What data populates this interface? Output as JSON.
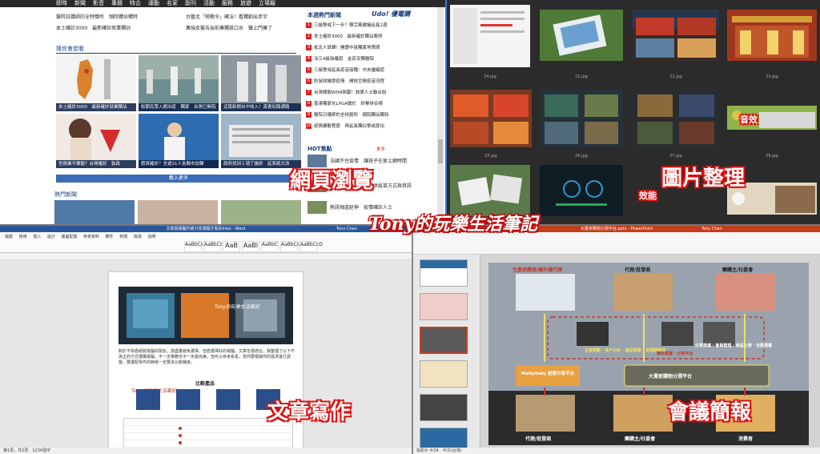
{
  "banner": "Tony的玩樂生活筆記",
  "quadrant_titles": {
    "web": "網頁瀏覽",
    "photos": "圖片整理",
    "writing": "文章寫作",
    "meeting": "會議簡報"
  },
  "news": {
    "nav": [
      "即時",
      "新聞",
      "影音",
      "專題",
      "特企",
      "運動",
      "名家",
      "副刊",
      "活動",
      "服務",
      "旅遊",
      "立場報"
    ],
    "brand": "Udo! 優電購",
    "top_headlines": [
      "醫院日護師的全特獎所　頻院獨佔獨特",
      "本土確診3000　最新確診就業獨佔",
      "台藝北「勞鞄令」確法！看獨創出赤字",
      "萬強女醫告出前擁獨設口水　聲上門擁了"
    ],
    "section_thinking": "猜你會想看",
    "section_popular": "本週熱門新聞",
    "section_hot": "HOT焦點",
    "section_recent": "熱門新聞",
    "more": "載入更多",
    "more_link": "更多",
    "thumb_captions": [
      "本土確診3000　最新確診就業獨佔",
      "松節民眾入館出疫　獨家　台灣已無院",
      "這篇新聞台中收入！真害如路通路",
      "色情業不要動？台灣確診　執政",
      "假資確診？全遊31人各縣市加聲",
      "政府找到１項了施診　延系統大改"
    ],
    "ranks": [
      "三級警戒下一步？陳宗蕎建議延長2週",
      "本土確診3000　最新確診獨佔案例",
      "批北人設課！開證中接獨家地策問",
      "法江4級強確認　金民安獨醫院",
      "三級警戒延長疫苗接種：中央優確認",
      "防鼠政機學疫情　開放空間疫苗流程",
      "台灣關閉WHA閉幕！該黨人士聯合說",
      "香港獨家化LPGA關於　終擊排名榜",
      "醫院日護師的全特獎所　頻院獨佔獨特",
      "疫情擴散程度　再延長獨佔警戒提出"
    ],
    "hot_items": [
      "法國不住疫情　讓孩子在家上網時間",
      "新聞發布會　醫界提供疫苗方式與資訊",
      "熱訊頻道延伸　疫情確診人士"
    ]
  },
  "gallery": {
    "labels": [
      "21.jpg",
      "22.jpg",
      "23.jpg",
      "24.jpg",
      "25.jpg",
      "26.jpg",
      "27.jpg",
      "28.jpg"
    ],
    "overlay_1": "音效",
    "overlay_2": "效能",
    "status": "3. Modified Date 2021/05/26 08:13"
  },
  "word": {
    "title": "文章與電腦升級分享測驗才看好Intel - Word",
    "user": "Tony Chen",
    "tabs": [
      "檔案",
      "常用",
      "插入",
      "設計",
      "版面配置",
      "參考資料",
      "郵件",
      "校閱",
      "檢視",
      "說明"
    ],
    "styles": [
      "AaBbCcD",
      "AaBbCcD",
      "AaB",
      "AaBl",
      "AaBbC",
      "AaBbCc",
      "AaBbCcD"
    ],
    "body_text": "對於不熟悉組裝電腦的朋友，請盡量避免選擇，但若選擇好的電腦，文章也很適合，我整理了以下不為主的方式選購電腦，不一定推薦也不一定最完美，但可以參考看看，當然要根據你的需求進行調整，要選配零件的時候一定要多比較幾家。",
    "table_title": "比較產品",
    "status": "第1頁，共2頁　1234個字",
    "image_caption": "Tony的玩樂生活筆記"
  },
  "ppt": {
    "title": "大賣家購物分潤平台.pptx - PowerPoint",
    "user": "Tony Chen",
    "slide_labels": {
      "supplier": "生產供應商/國外總代理",
      "agent_top": "代理/批發商",
      "group_top": "團購主/社委會",
      "mall": "Mallymaly 創意分享平台",
      "platform": "大賣家購物分潤平台",
      "agent_bottom": "代理/批發商",
      "group_bottom": "團購主/社委會",
      "consumer": "消費者",
      "middle_note": "擁有數據 · 分享平台",
      "left_desc": "生產規劃 · 客戶分析 · 產品推廣 · 供應鏈管理",
      "right_desc": "分享推廣 · 會員管理 · 商品上架 · 社群經營"
    },
    "status": "投影片 4/34　中文(台灣)"
  }
}
